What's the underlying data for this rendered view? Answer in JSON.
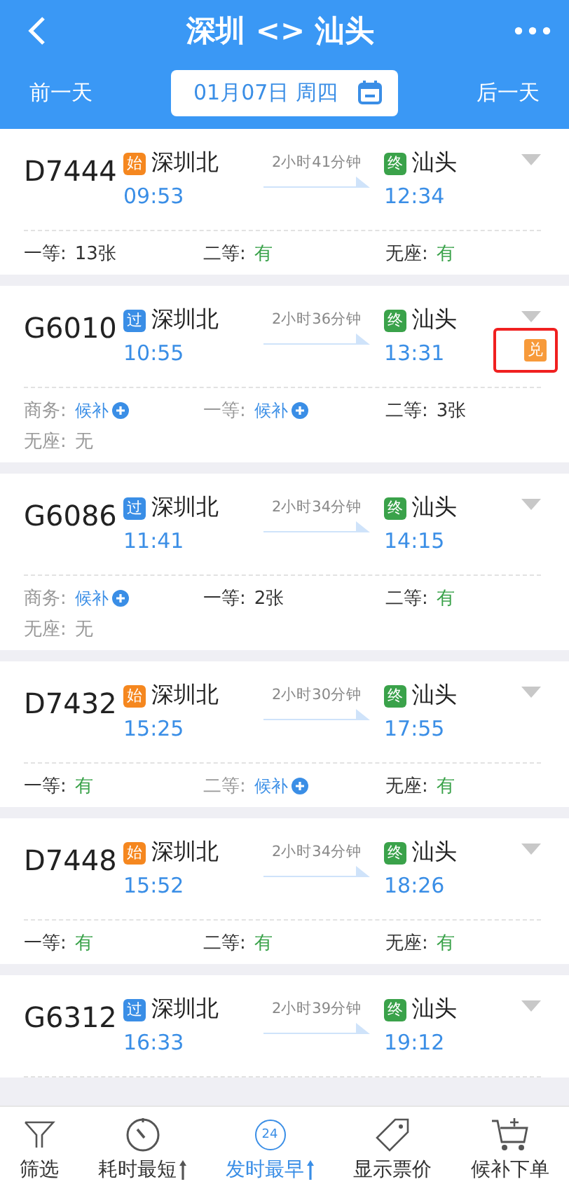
{
  "header": {
    "title": "深圳 <> 汕头",
    "prev_day": "前一天",
    "date": "01月07日 周四",
    "next_day": "后一天"
  },
  "trains": [
    {
      "number": "D7444",
      "from": {
        "badge": "始",
        "kind": "start",
        "station": "深圳北",
        "time": "09:53"
      },
      "duration": "2小时41分钟",
      "to": {
        "badge": "终",
        "kind": "end",
        "station": "汕头",
        "time": "12:34"
      },
      "seats": [
        {
          "label": "一等:",
          "value": "13张",
          "kind": "count"
        },
        {
          "label": "二等:",
          "value": "有",
          "kind": "available"
        },
        {
          "label": "无座:",
          "value": "有",
          "kind": "available"
        }
      ]
    },
    {
      "number": "G6010",
      "from": {
        "badge": "过",
        "kind": "pass",
        "station": "深圳北",
        "time": "10:55"
      },
      "duration": "2小时36分钟",
      "to": {
        "badge": "终",
        "kind": "end",
        "station": "汕头",
        "time": "13:31"
      },
      "exchange_badge": {
        "text": "兑",
        "highlighted": true
      },
      "seats": [
        {
          "label": "商务:",
          "value": "候补",
          "kind": "waitlist"
        },
        {
          "label": "一等:",
          "value": "候补",
          "kind": "waitlist"
        },
        {
          "label": "二等:",
          "value": "3张",
          "kind": "count"
        },
        {
          "label": "无座:",
          "value": "无",
          "kind": "none"
        }
      ]
    },
    {
      "number": "G6086",
      "from": {
        "badge": "过",
        "kind": "pass",
        "station": "深圳北",
        "time": "11:41"
      },
      "duration": "2小时34分钟",
      "to": {
        "badge": "终",
        "kind": "end",
        "station": "汕头",
        "time": "14:15"
      },
      "seats": [
        {
          "label": "商务:",
          "value": "候补",
          "kind": "waitlist"
        },
        {
          "label": "一等:",
          "value": "2张",
          "kind": "count"
        },
        {
          "label": "二等:",
          "value": "有",
          "kind": "available"
        },
        {
          "label": "无座:",
          "value": "无",
          "kind": "none"
        }
      ]
    },
    {
      "number": "D7432",
      "from": {
        "badge": "始",
        "kind": "start",
        "station": "深圳北",
        "time": "15:25"
      },
      "duration": "2小时30分钟",
      "to": {
        "badge": "终",
        "kind": "end",
        "station": "汕头",
        "time": "17:55"
      },
      "seats": [
        {
          "label": "一等:",
          "value": "有",
          "kind": "available"
        },
        {
          "label": "二等:",
          "value": "候补",
          "kind": "waitlist"
        },
        {
          "label": "无座:",
          "value": "有",
          "kind": "available"
        }
      ]
    },
    {
      "number": "D7448",
      "from": {
        "badge": "始",
        "kind": "start",
        "station": "深圳北",
        "time": "15:52"
      },
      "duration": "2小时34分钟",
      "to": {
        "badge": "终",
        "kind": "end",
        "station": "汕头",
        "time": "18:26"
      },
      "seats": [
        {
          "label": "一等:",
          "value": "有",
          "kind": "available"
        },
        {
          "label": "二等:",
          "value": "有",
          "kind": "available"
        },
        {
          "label": "无座:",
          "value": "有",
          "kind": "available"
        }
      ]
    },
    {
      "number": "G6312",
      "from": {
        "badge": "过",
        "kind": "pass",
        "station": "深圳北",
        "time": "16:33"
      },
      "duration": "2小时39分钟",
      "to": {
        "badge": "终",
        "kind": "end",
        "station": "汕头",
        "time": "19:12"
      }
    }
  ],
  "bottom_bar": [
    {
      "label": "筛选",
      "kind": "filter",
      "selected": false
    },
    {
      "label": "耗时最短",
      "kind": "duration",
      "selected": false
    },
    {
      "label": "发时最早",
      "kind": "departure",
      "icon_text": "24",
      "selected": true
    },
    {
      "label": "显示票价",
      "kind": "price",
      "selected": false
    },
    {
      "label": "候补下单",
      "kind": "cart",
      "selected": false
    }
  ]
}
